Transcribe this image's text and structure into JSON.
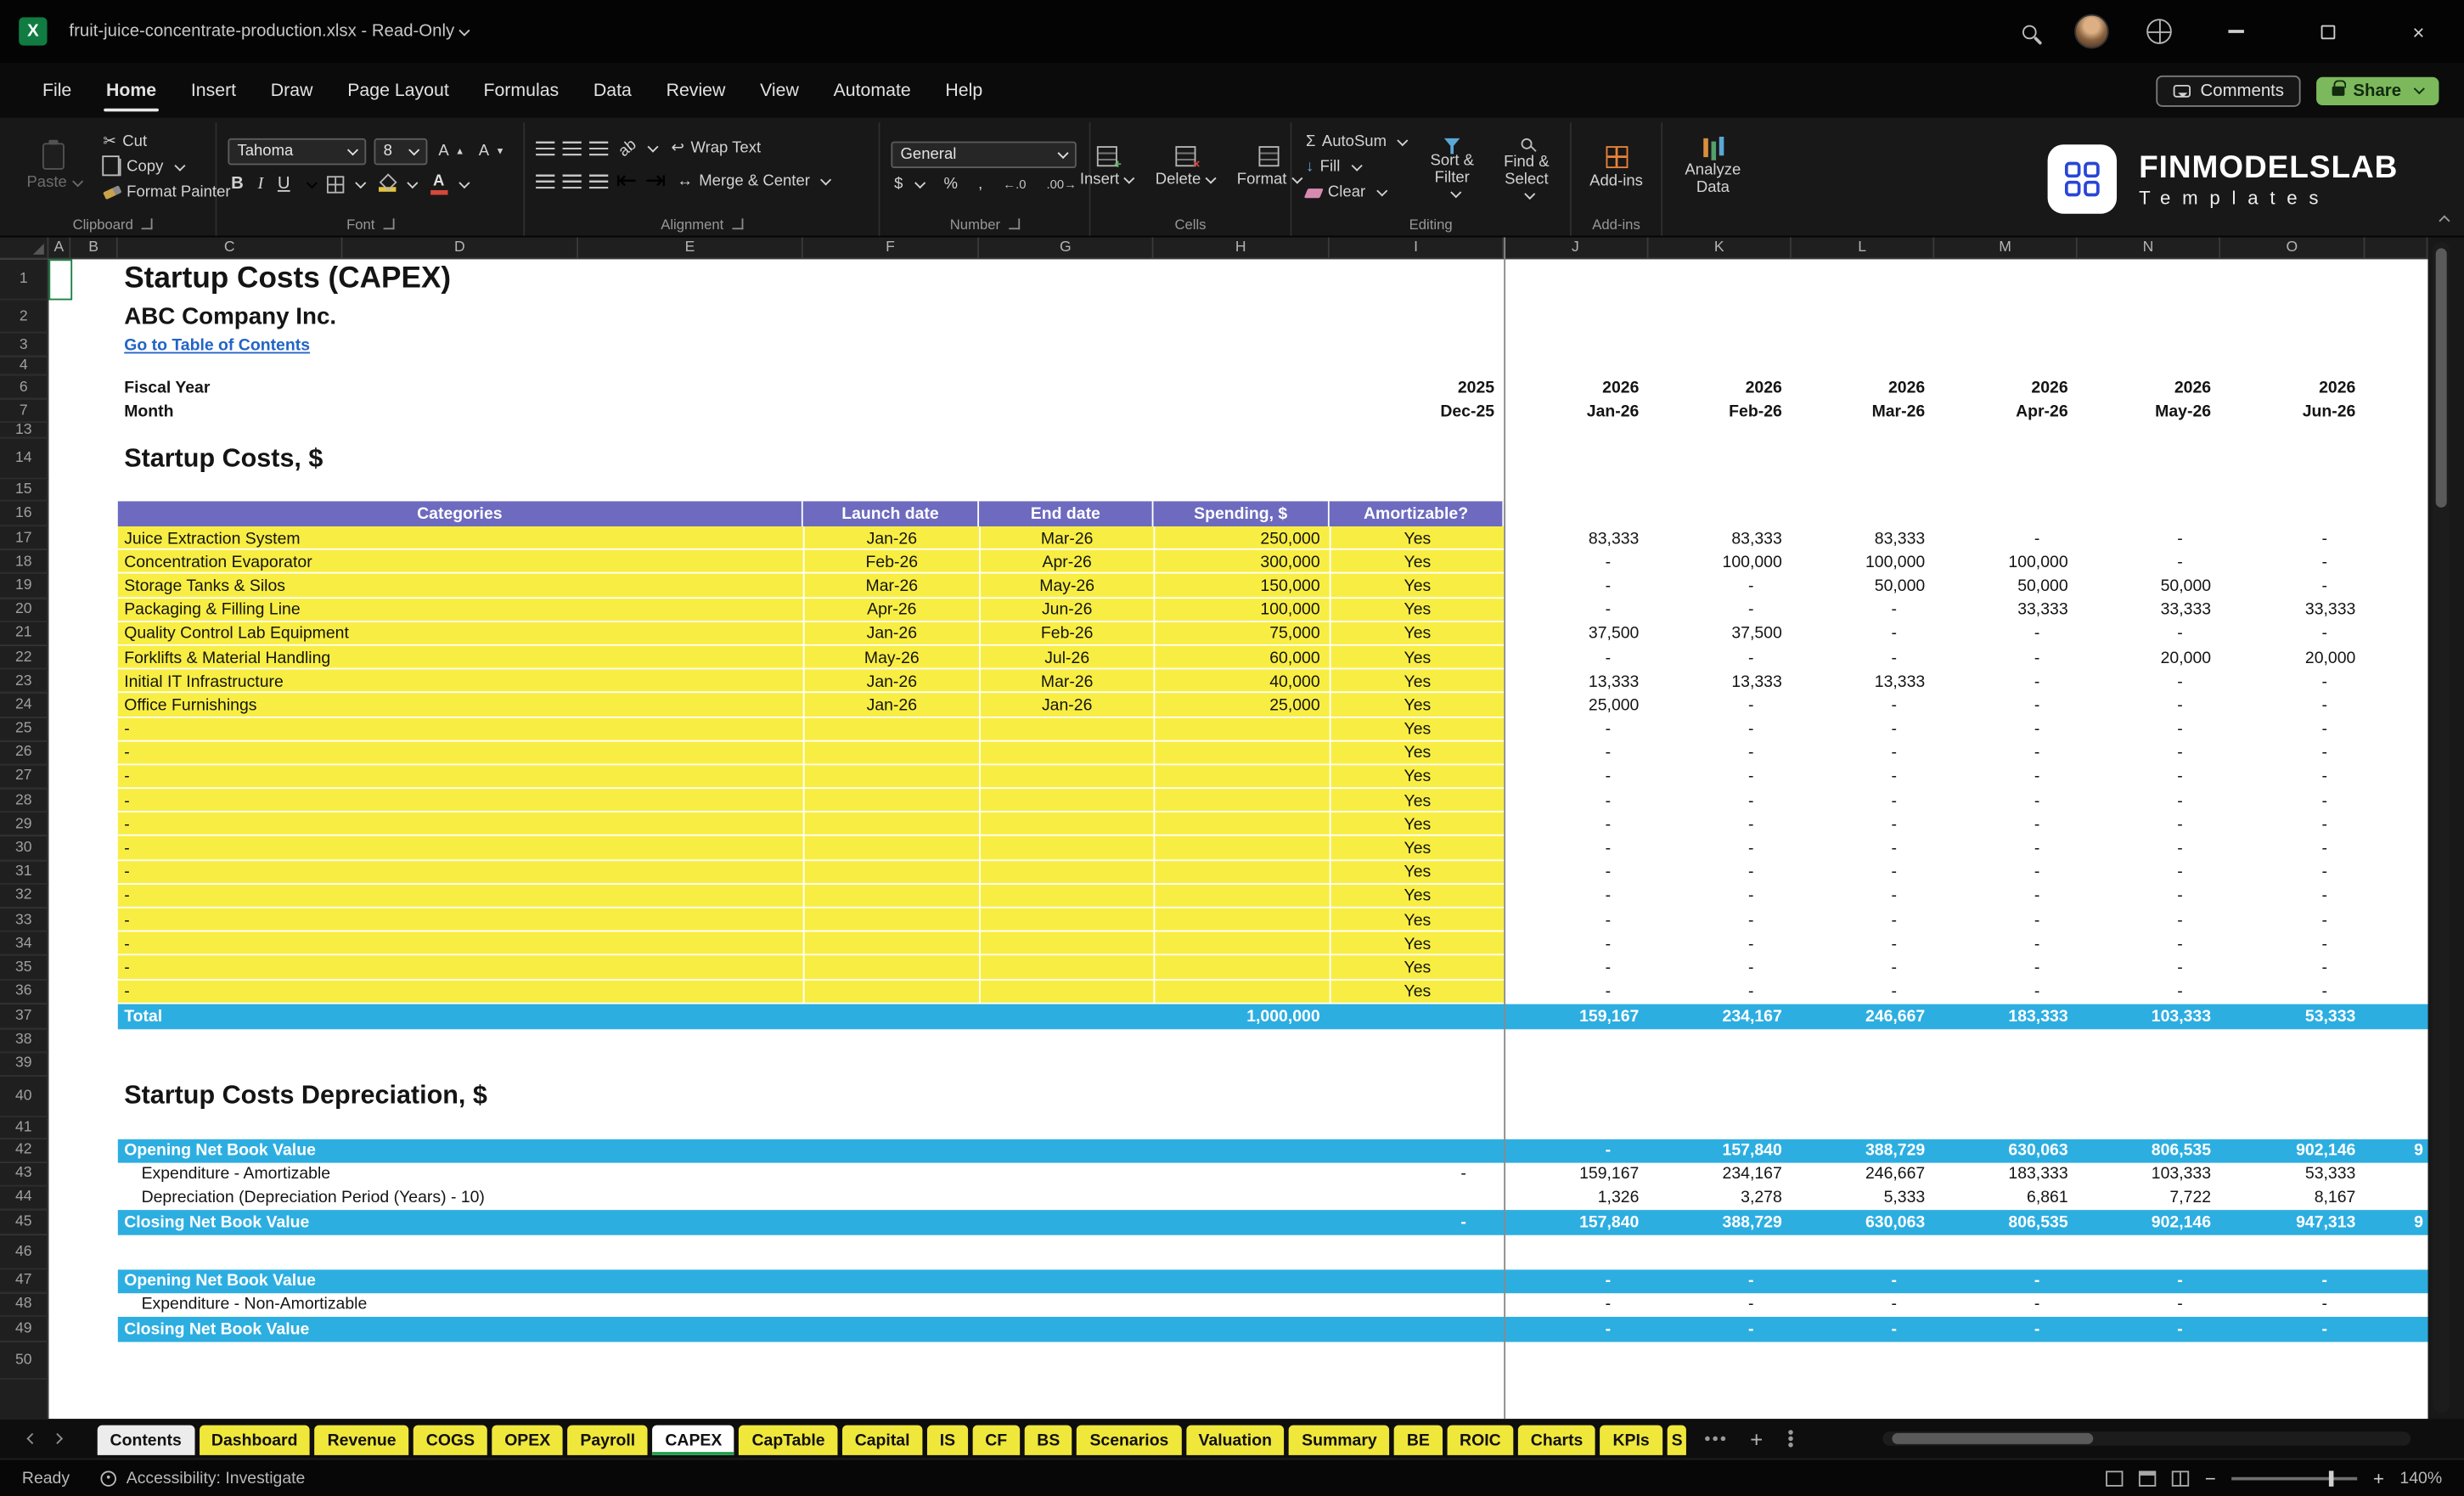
{
  "titlebar": {
    "title": "fruit-juice-concentrate-production.xlsx  -  Read-Only"
  },
  "menubar": {
    "tabs": [
      "File",
      "Home",
      "Insert",
      "Draw",
      "Page Layout",
      "Formulas",
      "Data",
      "Review",
      "View",
      "Automate",
      "Help"
    ],
    "active_tab": "Home",
    "comments_label": "Comments",
    "share_label": "Share"
  },
  "ribbon": {
    "clipboard": {
      "label": "Clipboard",
      "paste": "Paste",
      "cut": "Cut",
      "copy": "Copy",
      "format_painter": "Format Painter"
    },
    "font": {
      "label": "Font",
      "font_name": "Tahoma",
      "font_size": "8"
    },
    "alignment": {
      "label": "Alignment",
      "wrap_text": "Wrap Text",
      "merge_center": "Merge & Center"
    },
    "number": {
      "label": "Number",
      "format": "General"
    },
    "cells": {
      "label": "Cells",
      "insert": "Insert",
      "delete": "Delete",
      "format": "Format"
    },
    "editing": {
      "label": "Editing",
      "autosum": "AutoSum",
      "fill": "Fill",
      "clear": "Clear",
      "sort_filter": "Sort & Filter",
      "find_select": "Find & Select"
    },
    "addins": {
      "label": "Add-ins",
      "button": "Add-ins",
      "analyze_data": "Analyze Data"
    },
    "brand": {
      "name": "FINMODELSLAB",
      "subtitle": "Templates"
    }
  },
  "grid": {
    "columns": [
      "A",
      "B",
      "C",
      "D",
      "E",
      "F",
      "G",
      "H",
      "I",
      "J",
      "K",
      "L",
      "M",
      "N",
      "O"
    ],
    "rows": [
      {
        "n": 1,
        "kind": "text",
        "col": "C",
        "style": "t1",
        "text": "Startup Costs (CAPEX)"
      },
      {
        "n": 2,
        "kind": "text",
        "col": "C",
        "style": "t2",
        "text": "ABC Company Inc."
      },
      {
        "n": 3,
        "kind": "text",
        "col": "C",
        "style": "link",
        "text": "Go to Table of Contents"
      },
      {
        "n": 4,
        "kind": "empty"
      },
      {
        "n": 6,
        "kind": "months",
        "label": "Fiscal Year",
        "dec": "2025",
        "months": [
          "2026",
          "2026",
          "2026",
          "2026",
          "2026",
          "2026"
        ]
      },
      {
        "n": 7,
        "kind": "months",
        "label": "Month",
        "dec": "Dec-25",
        "months": [
          "Jan-26",
          "Feb-26",
          "Mar-26",
          "Apr-26",
          "May-26",
          "Jun-26"
        ]
      },
      {
        "n": 13,
        "kind": "empty"
      },
      {
        "n": 14,
        "kind": "text",
        "col": "C",
        "style": "h2",
        "text": "Startup Costs, $"
      },
      {
        "n": 15,
        "kind": "empty"
      },
      {
        "n": 16,
        "kind": "thead",
        "headers": [
          "Categories",
          "Launch date",
          "End date",
          "Spending, $",
          "Amortizable?"
        ]
      },
      {
        "n": 17,
        "kind": "capex",
        "category": "Juice Extraction System",
        "launch": "Jan-26",
        "end": "Mar-26",
        "spending": "250,000",
        "amortizable": "Yes",
        "monthly": [
          "83,333",
          "83,333",
          "83,333",
          "-",
          "-",
          "-"
        ]
      },
      {
        "n": 18,
        "kind": "capex",
        "category": "Concentration Evaporator",
        "launch": "Feb-26",
        "end": "Apr-26",
        "spending": "300,000",
        "amortizable": "Yes",
        "monthly": [
          "-",
          "100,000",
          "100,000",
          "100,000",
          "-",
          "-"
        ]
      },
      {
        "n": 19,
        "kind": "capex",
        "category": "Storage Tanks & Silos",
        "launch": "Mar-26",
        "end": "May-26",
        "spending": "150,000",
        "amortizable": "Yes",
        "monthly": [
          "-",
          "-",
          "50,000",
          "50,000",
          "50,000",
          "-"
        ]
      },
      {
        "n": 20,
        "kind": "capex",
        "category": "Packaging & Filling Line",
        "launch": "Apr-26",
        "end": "Jun-26",
        "spending": "100,000",
        "amortizable": "Yes",
        "monthly": [
          "-",
          "-",
          "-",
          "33,333",
          "33,333",
          "33,333"
        ]
      },
      {
        "n": 21,
        "kind": "capex",
        "category": "Quality Control Lab Equipment",
        "launch": "Jan-26",
        "end": "Feb-26",
        "spending": "75,000",
        "amortizable": "Yes",
        "monthly": [
          "37,500",
          "37,500",
          "-",
          "-",
          "-",
          "-"
        ]
      },
      {
        "n": 22,
        "kind": "capex",
        "category": "Forklifts & Material Handling",
        "launch": "May-26",
        "end": "Jul-26",
        "spending": "60,000",
        "amortizable": "Yes",
        "monthly": [
          "-",
          "-",
          "-",
          "-",
          "20,000",
          "20,000"
        ]
      },
      {
        "n": 23,
        "kind": "capex",
        "category": "Initial IT Infrastructure",
        "launch": "Jan-26",
        "end": "Mar-26",
        "spending": "40,000",
        "amortizable": "Yes",
        "monthly": [
          "13,333",
          "13,333",
          "13,333",
          "-",
          "-",
          "-"
        ]
      },
      {
        "n": 24,
        "kind": "capex",
        "category": "Office Furnishings",
        "launch": "Jan-26",
        "end": "Jan-26",
        "spending": "25,000",
        "amortizable": "Yes",
        "monthly": [
          "25,000",
          "-",
          "-",
          "-",
          "-",
          "-"
        ]
      },
      {
        "n": 25,
        "kind": "capex",
        "category": "-",
        "launch": "",
        "end": "",
        "spending": "",
        "amortizable": "Yes",
        "monthly": [
          "-",
          "-",
          "-",
          "-",
          "-",
          "-"
        ]
      },
      {
        "n": 26,
        "kind": "capex",
        "category": "-",
        "launch": "",
        "end": "",
        "spending": "",
        "amortizable": "Yes",
        "monthly": [
          "-",
          "-",
          "-",
          "-",
          "-",
          "-"
        ]
      },
      {
        "n": 27,
        "kind": "capex",
        "category": "-",
        "launch": "",
        "end": "",
        "spending": "",
        "amortizable": "Yes",
        "monthly": [
          "-",
          "-",
          "-",
          "-",
          "-",
          "-"
        ]
      },
      {
        "n": 28,
        "kind": "capex",
        "category": "-",
        "launch": "",
        "end": "",
        "spending": "",
        "amortizable": "Yes",
        "monthly": [
          "-",
          "-",
          "-",
          "-",
          "-",
          "-"
        ]
      },
      {
        "n": 29,
        "kind": "capex",
        "category": "-",
        "launch": "",
        "end": "",
        "spending": "",
        "amortizable": "Yes",
        "monthly": [
          "-",
          "-",
          "-",
          "-",
          "-",
          "-"
        ]
      },
      {
        "n": 30,
        "kind": "capex",
        "category": "-",
        "launch": "",
        "end": "",
        "spending": "",
        "amortizable": "Yes",
        "monthly": [
          "-",
          "-",
          "-",
          "-",
          "-",
          "-"
        ]
      },
      {
        "n": 31,
        "kind": "capex",
        "category": "-",
        "launch": "",
        "end": "",
        "spending": "",
        "amortizable": "Yes",
        "monthly": [
          "-",
          "-",
          "-",
          "-",
          "-",
          "-"
        ]
      },
      {
        "n": 32,
        "kind": "capex",
        "category": "-",
        "launch": "",
        "end": "",
        "spending": "",
        "amortizable": "Yes",
        "monthly": [
          "-",
          "-",
          "-",
          "-",
          "-",
          "-"
        ]
      },
      {
        "n": 33,
        "kind": "capex",
        "category": "-",
        "launch": "",
        "end": "",
        "spending": "",
        "amortizable": "Yes",
        "monthly": [
          "-",
          "-",
          "-",
          "-",
          "-",
          "-"
        ]
      },
      {
        "n": 34,
        "kind": "capex",
        "category": "-",
        "launch": "",
        "end": "",
        "spending": "",
        "amortizable": "Yes",
        "monthly": [
          "-",
          "-",
          "-",
          "-",
          "-",
          "-"
        ]
      },
      {
        "n": 35,
        "kind": "capex",
        "category": "-",
        "launch": "",
        "end": "",
        "spending": "",
        "amortizable": "Yes",
        "monthly": [
          "-",
          "-",
          "-",
          "-",
          "-",
          "-"
        ]
      },
      {
        "n": 36,
        "kind": "capex",
        "category": "-",
        "launch": "",
        "end": "",
        "spending": "",
        "amortizable": "Yes",
        "monthly": [
          "-",
          "-",
          "-",
          "-",
          "-",
          "-"
        ]
      },
      {
        "n": 37,
        "kind": "total",
        "label": "Total",
        "spending": "1,000,000",
        "monthly": [
          "159,167",
          "234,167",
          "246,667",
          "183,333",
          "103,333",
          "53,333"
        ]
      },
      {
        "n": 38,
        "kind": "empty"
      },
      {
        "n": 39,
        "kind": "empty"
      },
      {
        "n": 40,
        "kind": "text",
        "col": "C",
        "style": "h2",
        "text": "Startup Costs Depreciation, $"
      },
      {
        "n": 41,
        "kind": "empty"
      },
      {
        "n": 42,
        "kind": "cyan",
        "label": "Opening Net Book Value",
        "dec": "",
        "monthly": [
          "-",
          "157,840",
          "388,729",
          "630,063",
          "806,535",
          "902,146"
        ],
        "partial": "9"
      },
      {
        "n": 43,
        "kind": "plainrow",
        "label": "Expenditure - Amortizable",
        "dec": "-",
        "monthly": [
          "159,167",
          "234,167",
          "246,667",
          "183,333",
          "103,333",
          "53,333"
        ]
      },
      {
        "n": 44,
        "kind": "plainrow",
        "label": "Depreciation (Depreciation Period (Years) - 10)",
        "dec": "",
        "monthly": [
          "1,326",
          "3,278",
          "5,333",
          "6,861",
          "7,722",
          "8,167"
        ]
      },
      {
        "n": 45,
        "kind": "cyan",
        "label": "Closing Net Book Value",
        "dec": "-",
        "monthly": [
          "157,840",
          "388,729",
          "630,063",
          "806,535",
          "902,146",
          "947,313"
        ],
        "partial": "9"
      },
      {
        "n": 46,
        "kind": "empty"
      },
      {
        "n": 47,
        "kind": "cyan",
        "label": "Opening Net Book Value",
        "dec": "",
        "monthly": [
          "-",
          "-",
          "-",
          "-",
          "-",
          "-"
        ],
        "partial": ""
      },
      {
        "n": 48,
        "kind": "plainrow",
        "label": "Expenditure - Non-Amortizable",
        "dec": "",
        "monthly": [
          "-",
          "-",
          "-",
          "-",
          "-",
          "-"
        ]
      },
      {
        "n": 49,
        "kind": "cyan",
        "label": "Closing Net Book Value",
        "dec": "",
        "monthly": [
          "-",
          "-",
          "-",
          "-",
          "-",
          "-"
        ],
        "partial": ""
      },
      {
        "n": 50,
        "kind": "empty"
      }
    ]
  },
  "sheet_tabs": {
    "items": [
      {
        "label": "Contents",
        "style": "light"
      },
      {
        "label": "Dashboard",
        "style": "yellow"
      },
      {
        "label": "Revenue",
        "style": "yellow"
      },
      {
        "label": "COGS",
        "style": "yellow"
      },
      {
        "label": "OPEX",
        "style": "yellow"
      },
      {
        "label": "Payroll",
        "style": "yellow"
      },
      {
        "label": "CAPEX",
        "style": "light",
        "active": true
      },
      {
        "label": "CapTable",
        "style": "yellow"
      },
      {
        "label": "Capital",
        "style": "yellow"
      },
      {
        "label": "IS",
        "style": "yellow"
      },
      {
        "label": "CF",
        "style": "yellow"
      },
      {
        "label": "BS",
        "style": "yellow"
      },
      {
        "label": "Scenarios",
        "style": "yellow"
      },
      {
        "label": "Valuation",
        "style": "yellow"
      },
      {
        "label": "Summary",
        "style": "yellow"
      },
      {
        "label": "BE",
        "style": "yellow"
      },
      {
        "label": "ROIC",
        "style": "yellow"
      },
      {
        "label": "Charts",
        "style": "yellow"
      },
      {
        "label": "KPIs",
        "style": "yellow"
      },
      {
        "label": "S",
        "style": "yellow",
        "clipped": true
      }
    ]
  },
  "status_bar": {
    "ready": "Ready",
    "accessibility": "Accessibility: Investigate",
    "zoom": "140%"
  },
  "colors": {
    "table_yellow": "#F8EE43",
    "header_purple": "#6D6ABF",
    "band_cyan": "#2DAEE1",
    "link_blue": "#2264C6",
    "excel_green": "#107C41",
    "sheet_tab_yellow": "#F0E73B"
  }
}
